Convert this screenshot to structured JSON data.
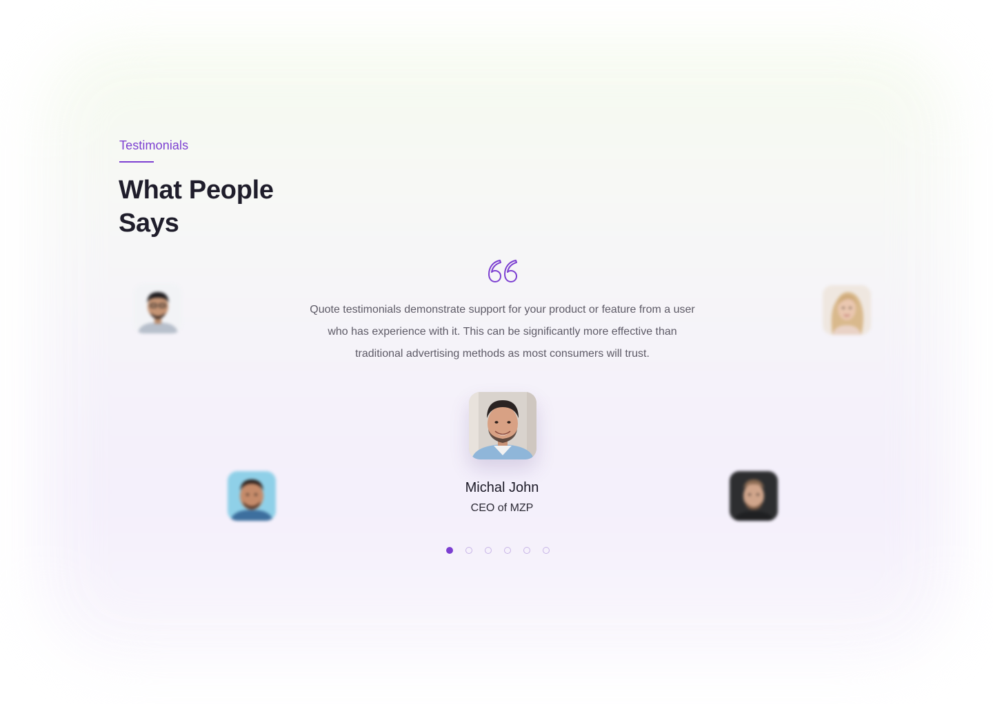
{
  "section": {
    "eyebrow": "Testimonials",
    "heading": "What People Says"
  },
  "testimonial": {
    "quote": "Quote testimonials demonstrate support for your product or feature from a user who has experience with it. This can be significantly more effective than traditional advertising methods as most consumers will trust.",
    "name": "Michal John",
    "role": "CEO of MZP"
  },
  "pagination": {
    "count": 6,
    "active_index": 0
  },
  "colors": {
    "accent": "#7c3fd1",
    "heading": "#1f1d2b",
    "body_text": "#5d5a66"
  },
  "icons": {
    "quote": "quote-open-icon"
  }
}
